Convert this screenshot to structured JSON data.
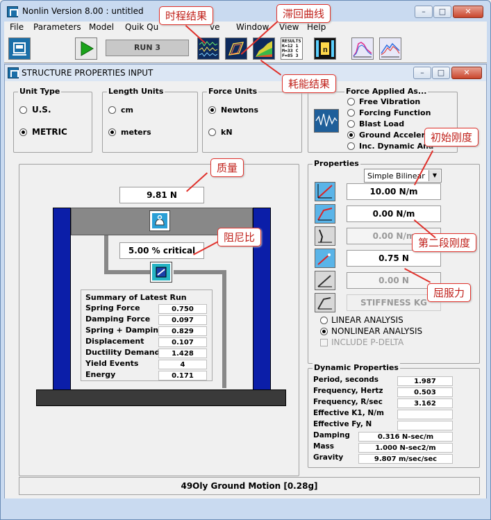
{
  "app": {
    "title": "Nonlin Version 8.00 : untitled"
  },
  "menu": {
    "items": [
      "File",
      "Parameters",
      "Model",
      "Quik Qu",
      "",
      "ve",
      "Window",
      "View",
      "Help"
    ]
  },
  "toolbar": {
    "run_label": "RUN  3",
    "results_icon_label": "RESULTS"
  },
  "inner_window": {
    "title": "STRUCTURE PROPERTIES INPUT"
  },
  "unit_type": {
    "legend": "Unit Type",
    "options": [
      "U.S.",
      "METRIC"
    ],
    "selected": "METRIC"
  },
  "length_units": {
    "legend": "Length Units",
    "options": [
      "cm",
      "meters"
    ],
    "selected": "meters"
  },
  "force_units": {
    "legend": "Force Units",
    "options": [
      "Newtons",
      "kN"
    ],
    "selected": "Newtons"
  },
  "force_applied": {
    "legend": "Force Applied As...",
    "options": [
      "Free Vibration",
      "Forcing Function",
      "Blast Load",
      "Ground Accelera",
      "Inc. Dynamic Ana"
    ],
    "selected": "Ground Accelera"
  },
  "model": {
    "mass_value": "9.81 N",
    "damping_value": "5.00 % critical"
  },
  "summary": {
    "title": "Summary of Latest Run",
    "rows": [
      {
        "label": "Spring Force",
        "value": "0.750"
      },
      {
        "label": "Damping Force",
        "value": "0.097"
      },
      {
        "label": "Spring + Damping",
        "value": "0.829"
      },
      {
        "label": "Displacement",
        "value": "0.107"
      },
      {
        "label": "Ductility Demand",
        "value": "1.428"
      },
      {
        "label": "Yield Events",
        "value": "4"
      },
      {
        "label": "Energy",
        "value": "0.171"
      }
    ]
  },
  "properties": {
    "legend": "Properties",
    "model_select": "Simple Bilinear",
    "fields": [
      "10.00 N/m",
      "0.00 N/m",
      "0.00 N/m",
      "0.75 N",
      "0.00 N",
      "STIFFNESS KG"
    ],
    "analysis": {
      "options": [
        "LINEAR ANALYSIS",
        "NONLINEAR ANALYSIS"
      ],
      "selected": "NONLINEAR ANALYSIS",
      "pdelta": "INCLUDE P-DELTA"
    }
  },
  "dynamic": {
    "legend": "Dynamic Properties",
    "rows": [
      {
        "label": "Period, seconds",
        "value": "1.987"
      },
      {
        "label": "Frequency, Hertz",
        "value": "0.503"
      },
      {
        "label": "Frequency, R/sec",
        "value": "3.162"
      },
      {
        "label": "Effective K1, N/m",
        "value": ""
      },
      {
        "label": "Effective Fy, N",
        "value": ""
      }
    ],
    "rows2": [
      {
        "label": "Damping",
        "value": "0.316 N-sec/m"
      },
      {
        "label": "Mass",
        "value": "1.000 N-sec2/m"
      },
      {
        "label": "Gravity",
        "value": "9.807 m/sec/sec"
      }
    ]
  },
  "status": {
    "ground_motion": "49Oly Ground Motion   [0.28g]"
  },
  "annotations": {
    "time_history": "时程结果",
    "hysteresis": "滞回曲线",
    "energy": "耗能结果",
    "mass": "质量",
    "damping": "阻尼比",
    "initial_stiffness": "初始刚度",
    "second_stiffness": "第二段刚度",
    "yield_force": "屈服力"
  }
}
